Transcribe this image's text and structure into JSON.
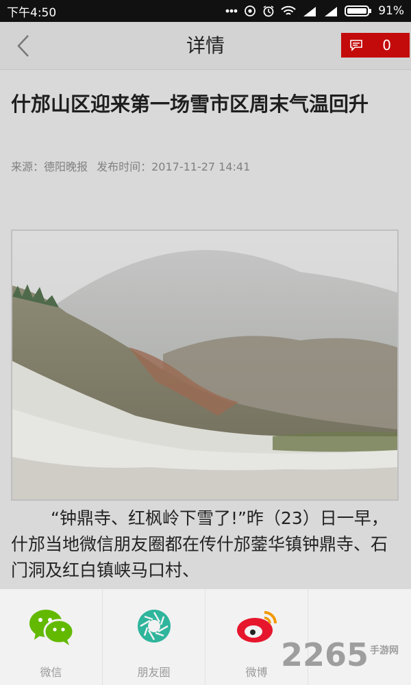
{
  "status_bar": {
    "time": "下午4:50",
    "battery": "91%"
  },
  "nav": {
    "title": "详情",
    "comment_count": "0"
  },
  "article": {
    "headline": "什邡山区迎来第一场雪市区周末气温回升",
    "source": "来源：德阳晚报",
    "published": "发布时间：2017-11-27 14:41",
    "body": "“钟鼎寺、红枫岭下雪了!”昨（23）日一早，什邡当地微信朋友圈都在传什邡蓥华镇钟鼎寺、石门洞及红白镇峡马口村、"
  },
  "share": {
    "wechat": "微信",
    "moments": "朋友圈",
    "weibo": "微博"
  },
  "watermark": {
    "number": "2265",
    "site": "手游网"
  },
  "colors": {
    "accent": "#c30b0b",
    "wechat": "#62b900",
    "moments": "#2fb59c",
    "weibo": "#e6162d"
  }
}
